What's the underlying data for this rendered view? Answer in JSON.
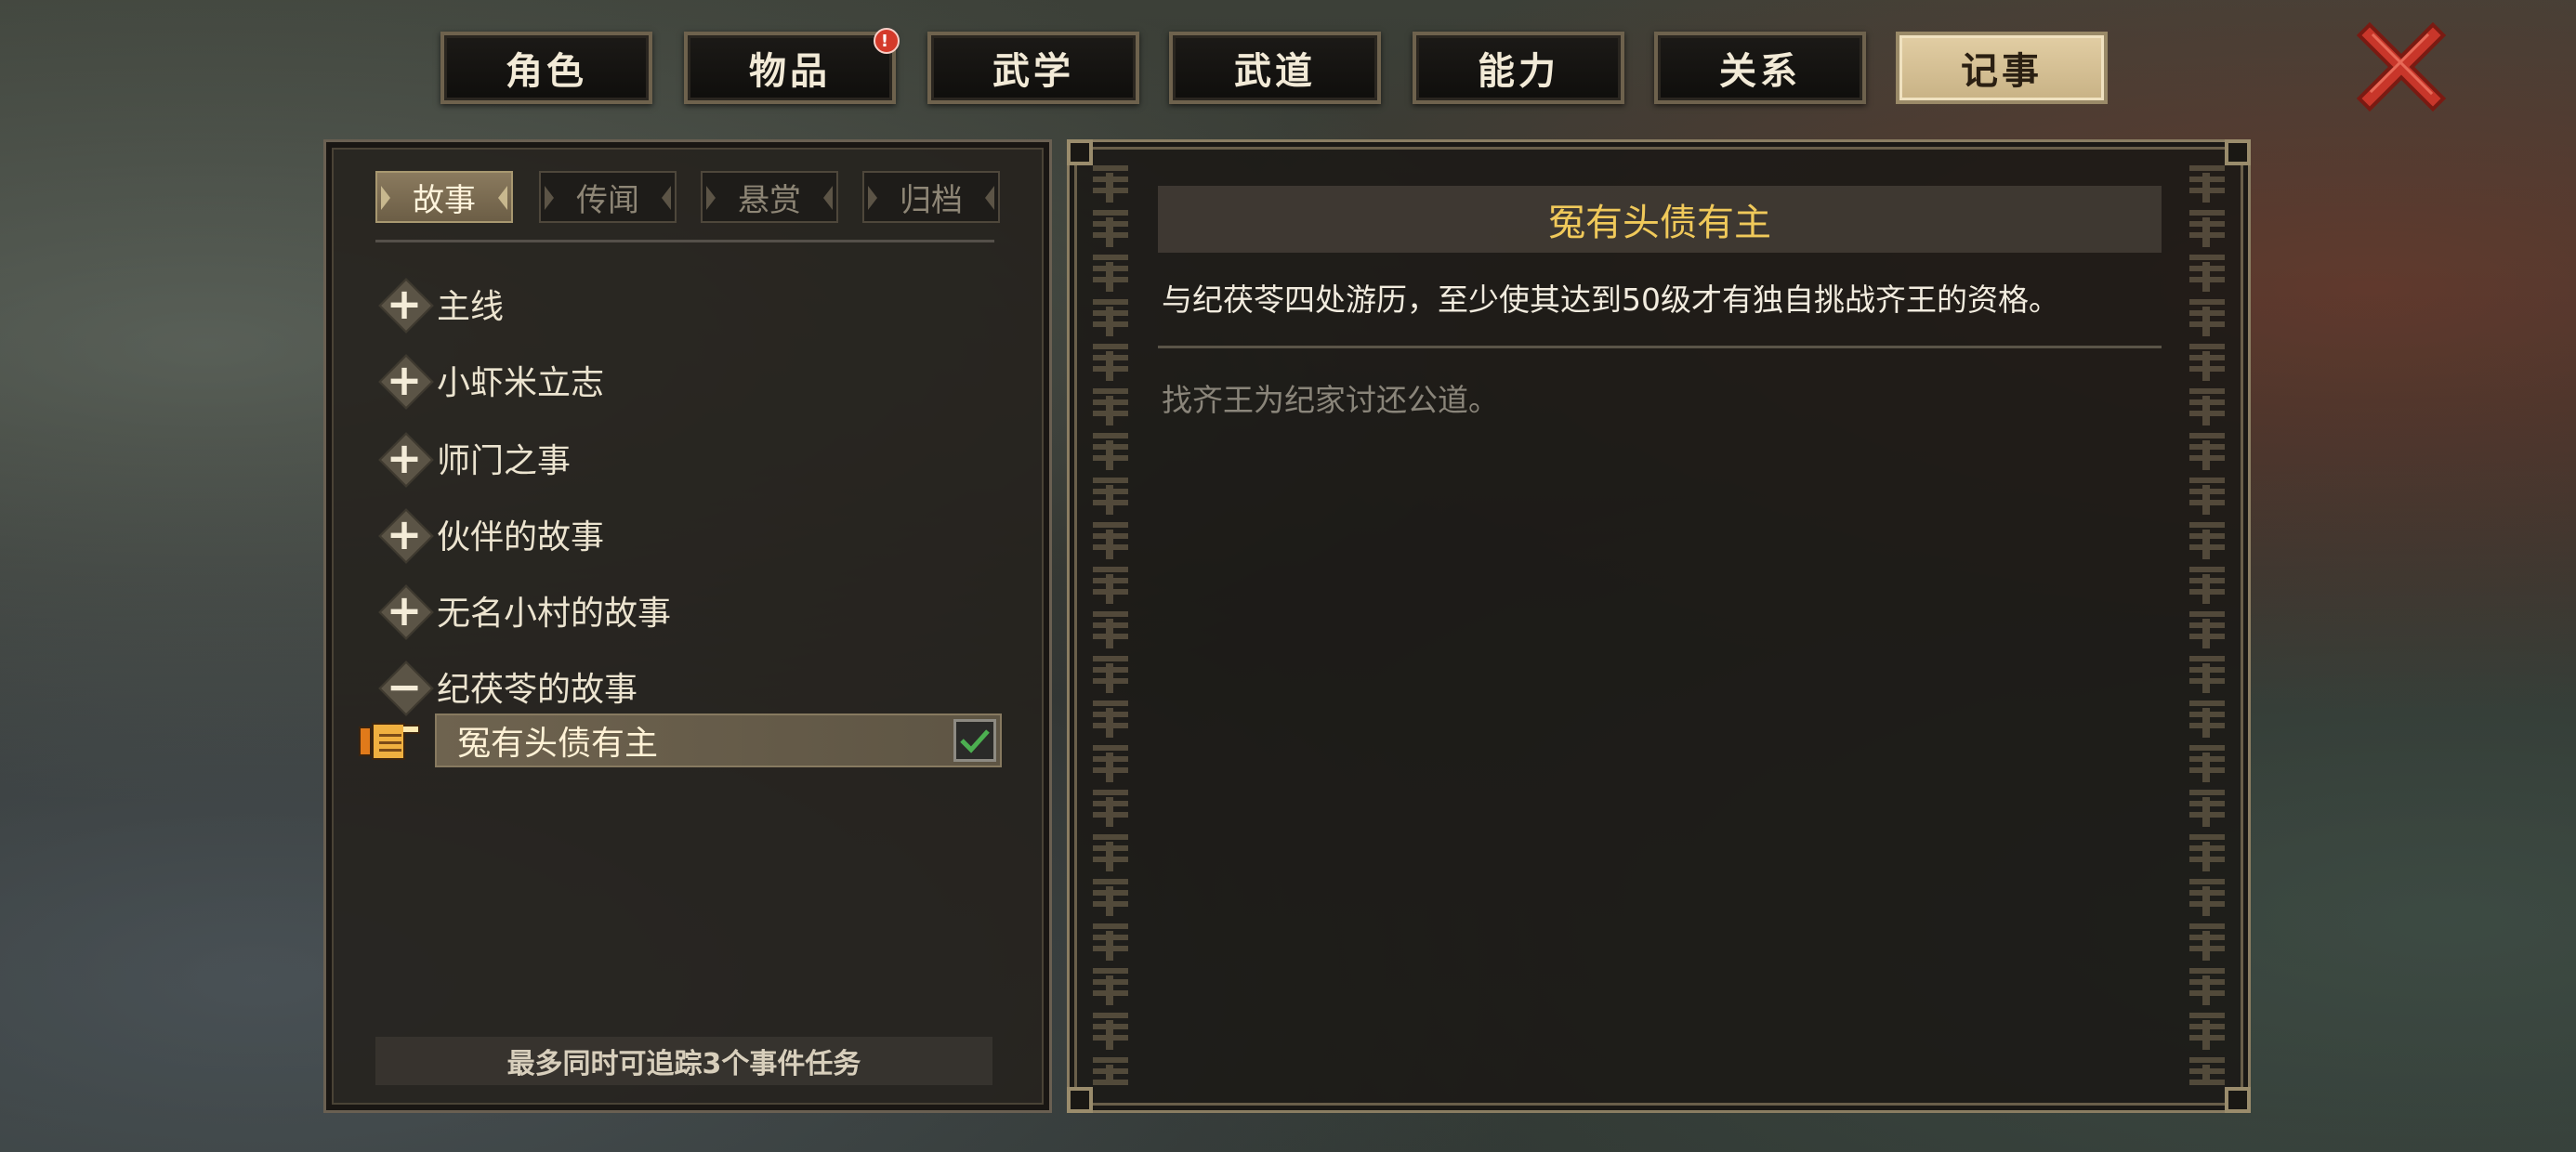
{
  "top_tabs": [
    {
      "label": "角色",
      "active": false
    },
    {
      "label": "物品",
      "active": false,
      "badge": "!"
    },
    {
      "label": "武学",
      "active": false
    },
    {
      "label": "武道",
      "active": false
    },
    {
      "label": "能力",
      "active": false
    },
    {
      "label": "关系",
      "active": false
    },
    {
      "label": "记事",
      "active": true
    }
  ],
  "close_icon": "close-x-icon",
  "sub_tabs": [
    {
      "label": "故事",
      "active": true
    },
    {
      "label": "传闻",
      "active": false
    },
    {
      "label": "悬赏",
      "active": false
    },
    {
      "label": "归档",
      "active": false
    }
  ],
  "quest_groups": [
    {
      "label": "主线",
      "state": "+"
    },
    {
      "label": "小虾米立志",
      "state": "+"
    },
    {
      "label": "师门之事",
      "state": "+"
    },
    {
      "label": "伙伴的故事",
      "state": "+"
    },
    {
      "label": "无名小村的故事",
      "state": "+"
    },
    {
      "label": "纪茯苓的故事",
      "state": "−"
    }
  ],
  "selected_quest": {
    "label": "冤有头债有主",
    "tracked": true
  },
  "footer_note": "最多同时可追踪3个事件任务",
  "detail": {
    "title": "冤有头债有主",
    "description": "与纪茯苓四处游历，至少使其达到50级才有独自挑战齐王的资格。",
    "goal": "找齐王为纪家讨还公道。"
  },
  "colors": {
    "title_gold": "#f0c95a",
    "active_tab": "#d6c195",
    "badge_red": "#d43a2a",
    "check_green": "#4caf50",
    "close_red": "#c8362a"
  }
}
